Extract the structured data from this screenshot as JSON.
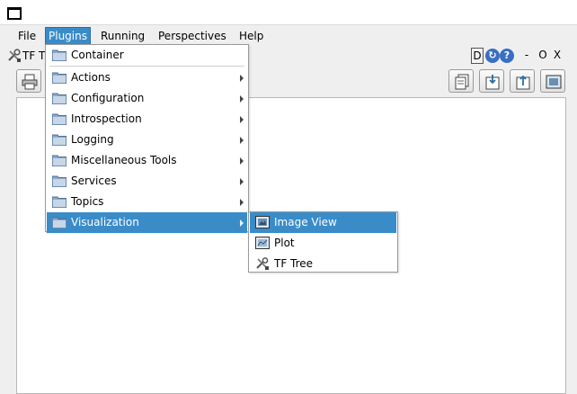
{
  "menubar": {
    "file": "File",
    "plugins": "Plugins",
    "running": "Running",
    "perspectives": "Perspectives",
    "help": "Help"
  },
  "plugin": {
    "title": "TF T",
    "buttons": {
      "d": "D",
      "refresh": "↻",
      "help": "?",
      "minimize": "-",
      "float": "O",
      "close": "X"
    }
  },
  "plugins_menu": {
    "items": [
      {
        "label": "Container",
        "submenu": false
      },
      {
        "label": "Actions",
        "submenu": true
      },
      {
        "label": "Configuration",
        "submenu": true
      },
      {
        "label": "Introspection",
        "submenu": true
      },
      {
        "label": "Logging",
        "submenu": true
      },
      {
        "label": "Miscellaneous Tools",
        "submenu": true
      },
      {
        "label": "Services",
        "submenu": true
      },
      {
        "label": "Topics",
        "submenu": true
      },
      {
        "label": "Visualization",
        "submenu": true
      }
    ],
    "highlighted": "Visualization"
  },
  "visualization_submenu": {
    "items": [
      {
        "label": "Image View",
        "icon": "image-icon"
      },
      {
        "label": "Plot",
        "icon": "image-icon"
      },
      {
        "label": "TF Tree",
        "icon": "tools-icon"
      }
    ],
    "highlighted": "Image View"
  },
  "colors": {
    "highlight": "#3a8cc9",
    "folder": "#8aa9cc"
  }
}
